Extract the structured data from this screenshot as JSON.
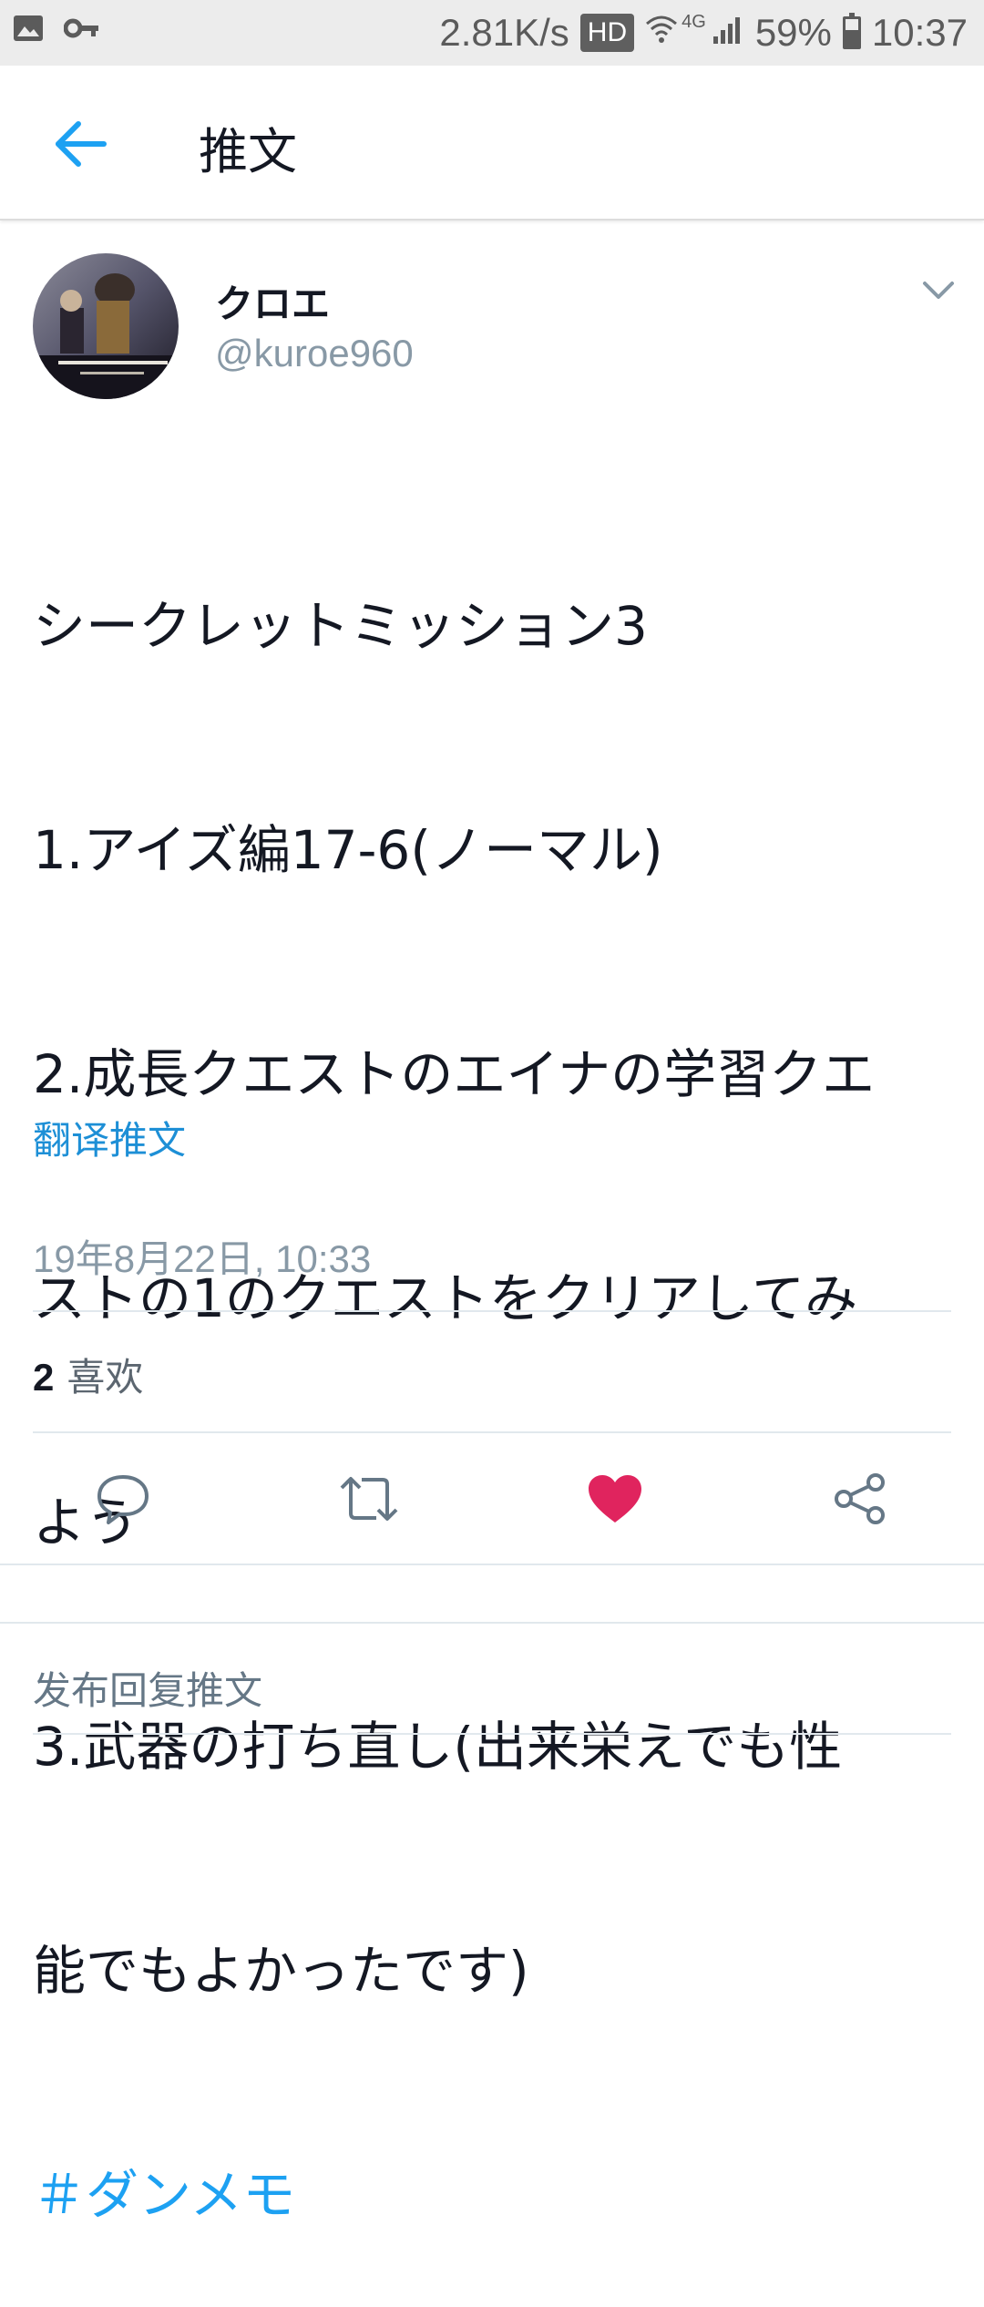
{
  "status_bar": {
    "speed": "2.81K/s",
    "hd": "HD",
    "network": "4G",
    "battery": "59%",
    "battery_level": 0.59,
    "time": "10:37",
    "icons": [
      "image-icon",
      "key-icon",
      "wifi-icon",
      "signal-icon",
      "battery-icon"
    ]
  },
  "header": {
    "title": "推文"
  },
  "tweet": {
    "author_name": "クロエ",
    "author_handle": "@kuroe960",
    "lines": [
      "シークレットミッション3",
      "1.アイズ編17-6(ノーマル)",
      "2.成長クエストのエイナの学習クエ",
      "ストの1のクエストをクリアしてみ",
      "よう",
      "3.武器の打ち直し(出来栄えでも性",
      "能でもよかったです)"
    ],
    "hashtag": "＃ダンメモ",
    "translate_label": "翻译推文",
    "timestamp": "19年8月22日, 10:33",
    "likes_count": "2",
    "likes_label": "喜欢",
    "liked": true
  },
  "actions": {
    "icons": [
      "reply-icon",
      "retweet-icon",
      "like-icon",
      "share-icon"
    ],
    "like_color": "#e0245e",
    "icon_color": "#657786"
  },
  "reply": {
    "placeholder": "发布回复推文"
  },
  "colors": {
    "accent": "#1da1f2",
    "secondary_text": "#8899a6"
  }
}
